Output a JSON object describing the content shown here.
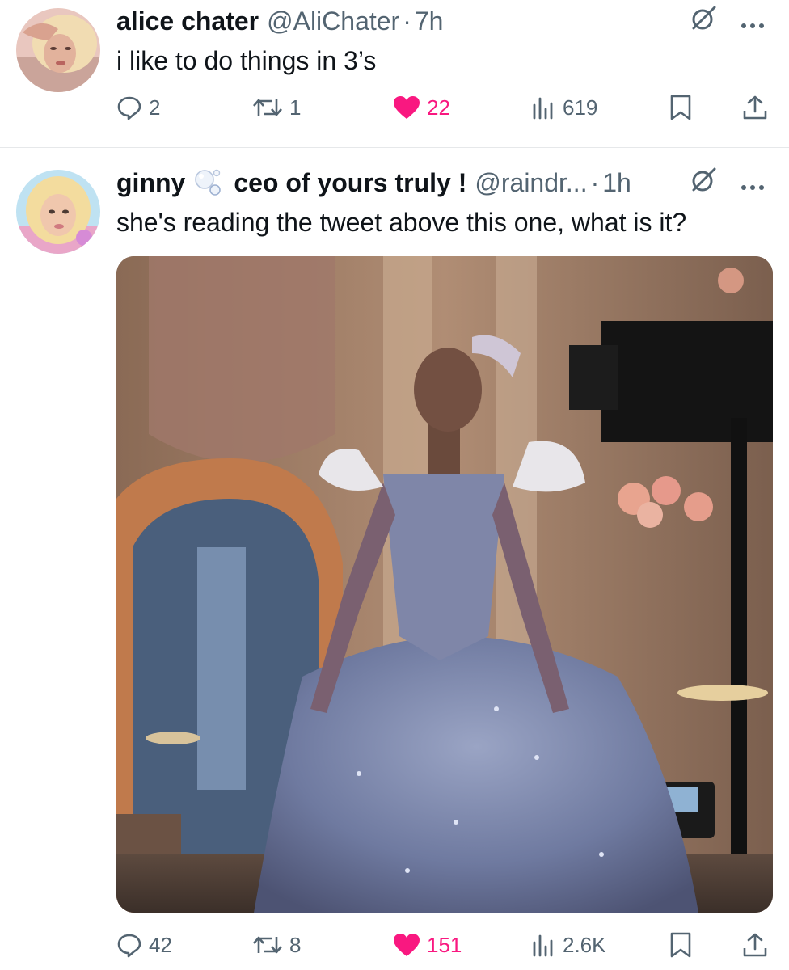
{
  "tweets": [
    {
      "display_name": "alice chater",
      "handle": "@AliChater",
      "separator": "·",
      "time": "7h",
      "text": "i like to do things in 3’s",
      "stats": {
        "replies": "2",
        "reposts": "1",
        "likes": "22",
        "views": "619"
      }
    },
    {
      "display_name": "ginny",
      "display_name_suffix": "ceo of yours truly !",
      "handle": "@raindr...",
      "separator": "·",
      "time": "1h",
      "text": "she's reading the tweet above this one, what is it?",
      "stats": {
        "replies": "42",
        "reposts": "8",
        "likes": "151",
        "views": "2.6K"
      }
    }
  ],
  "icons": {
    "reply": "speech-bubble-icon",
    "repost": "repost-arrows-icon",
    "like": "heart-icon",
    "views": "bar-chart-icon",
    "bookmark": "bookmark-icon",
    "share": "share-upload-icon",
    "grok": "slashed-circle-icon",
    "more": "ellipsis-icon",
    "name_emoji": "bubbles-emoji-icon"
  },
  "colors": {
    "like": "#f91880",
    "muted": "#536471",
    "text": "#0f1419",
    "divider": "#e6e8ea"
  }
}
